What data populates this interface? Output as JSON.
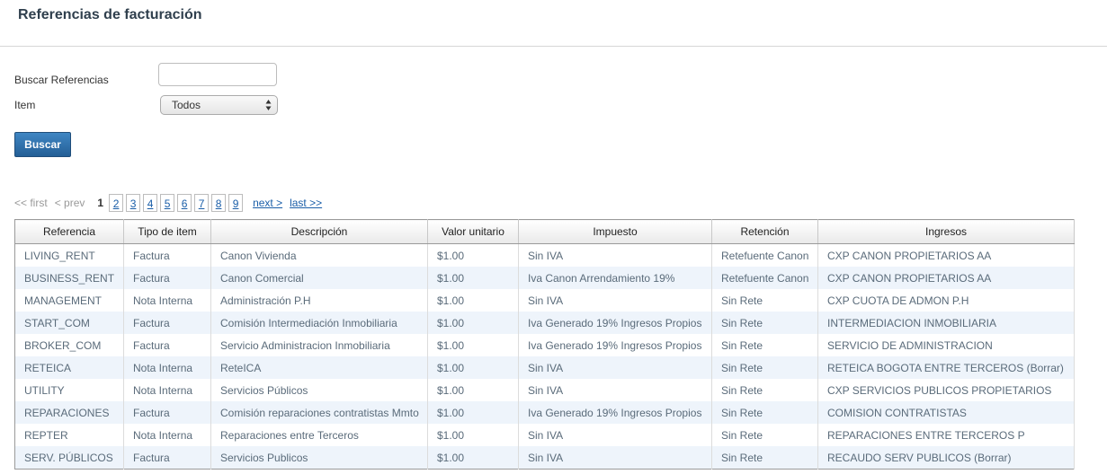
{
  "page": {
    "title": "Referencias de facturación"
  },
  "form": {
    "search_label": "Buscar Referencias",
    "search_value": "",
    "item_label": "Item",
    "item_selected": "Todos",
    "button_label": "Buscar"
  },
  "pager": {
    "first": "<< first",
    "prev": "< prev",
    "current": "1",
    "pages": [
      "2",
      "3",
      "4",
      "5",
      "6",
      "7",
      "8",
      "9"
    ],
    "next": "next >",
    "last": "last >>"
  },
  "table": {
    "headers": [
      "Referencia",
      "Tipo de item",
      "Descripción",
      "Valor unitario",
      "Impuesto",
      "Retención",
      "Ingresos"
    ],
    "rows": [
      [
        "LIVING_RENT",
        "Factura",
        "Canon Vivienda",
        "$1.00",
        "Sin IVA",
        "Retefuente Canon",
        "CXP CANON PROPIETARIOS AA"
      ],
      [
        "BUSINESS_RENT",
        "Factura",
        "Canon Comercial",
        "$1.00",
        "Iva Canon Arrendamiento 19%",
        "Retefuente Canon",
        "CXP CANON PROPIETARIOS AA"
      ],
      [
        "MANAGEMENT",
        "Nota Interna",
        "Administración P.H",
        "$1.00",
        "Sin IVA",
        "Sin Rete",
        "CXP CUOTA DE ADMON P.H"
      ],
      [
        "START_COM",
        "Factura",
        "Comisión Intermediación Inmobiliaria",
        "$1.00",
        "Iva Generado 19% Ingresos Propios",
        "Sin Rete",
        "INTERMEDIACION INMOBILIARIA"
      ],
      [
        "BROKER_COM",
        "Factura",
        "Servicio Administracion Inmobiliaria",
        "$1.00",
        "Iva Generado 19% Ingresos Propios",
        "Sin Rete",
        "SERVICIO DE ADMINISTRACION"
      ],
      [
        "RETEICA",
        "Nota Interna",
        "ReteICA",
        "$1.00",
        "Sin IVA",
        "Sin Rete",
        "RETEICA BOGOTA ENTRE TERCEROS (Borrar)"
      ],
      [
        "UTILITY",
        "Nota Interna",
        "Servicios Públicos",
        "$1.00",
        "Sin IVA",
        "Sin Rete",
        "CXP SERVICIOS PUBLICOS PROPIETARIOS"
      ],
      [
        "REPARACIONES",
        "Factura",
        "Comisión reparaciones contratistas Mmto",
        "$1.00",
        "Iva Generado 19% Ingresos Propios",
        "Sin Rete",
        "COMISION CONTRATISTAS"
      ],
      [
        "REPTER",
        "Nota Interna",
        "Reparaciones entre Terceros",
        "$1.00",
        "Sin IVA",
        "Sin Rete",
        "REPARACIONES ENTRE TERCEROS P"
      ],
      [
        "SERV. PÚBLICOS",
        "Factura",
        "Servicios Publicos",
        "$1.00",
        "Sin IVA",
        "Sin Rete",
        "RECAUDO SERV PUBLICOS (Borrar)"
      ]
    ]
  }
}
